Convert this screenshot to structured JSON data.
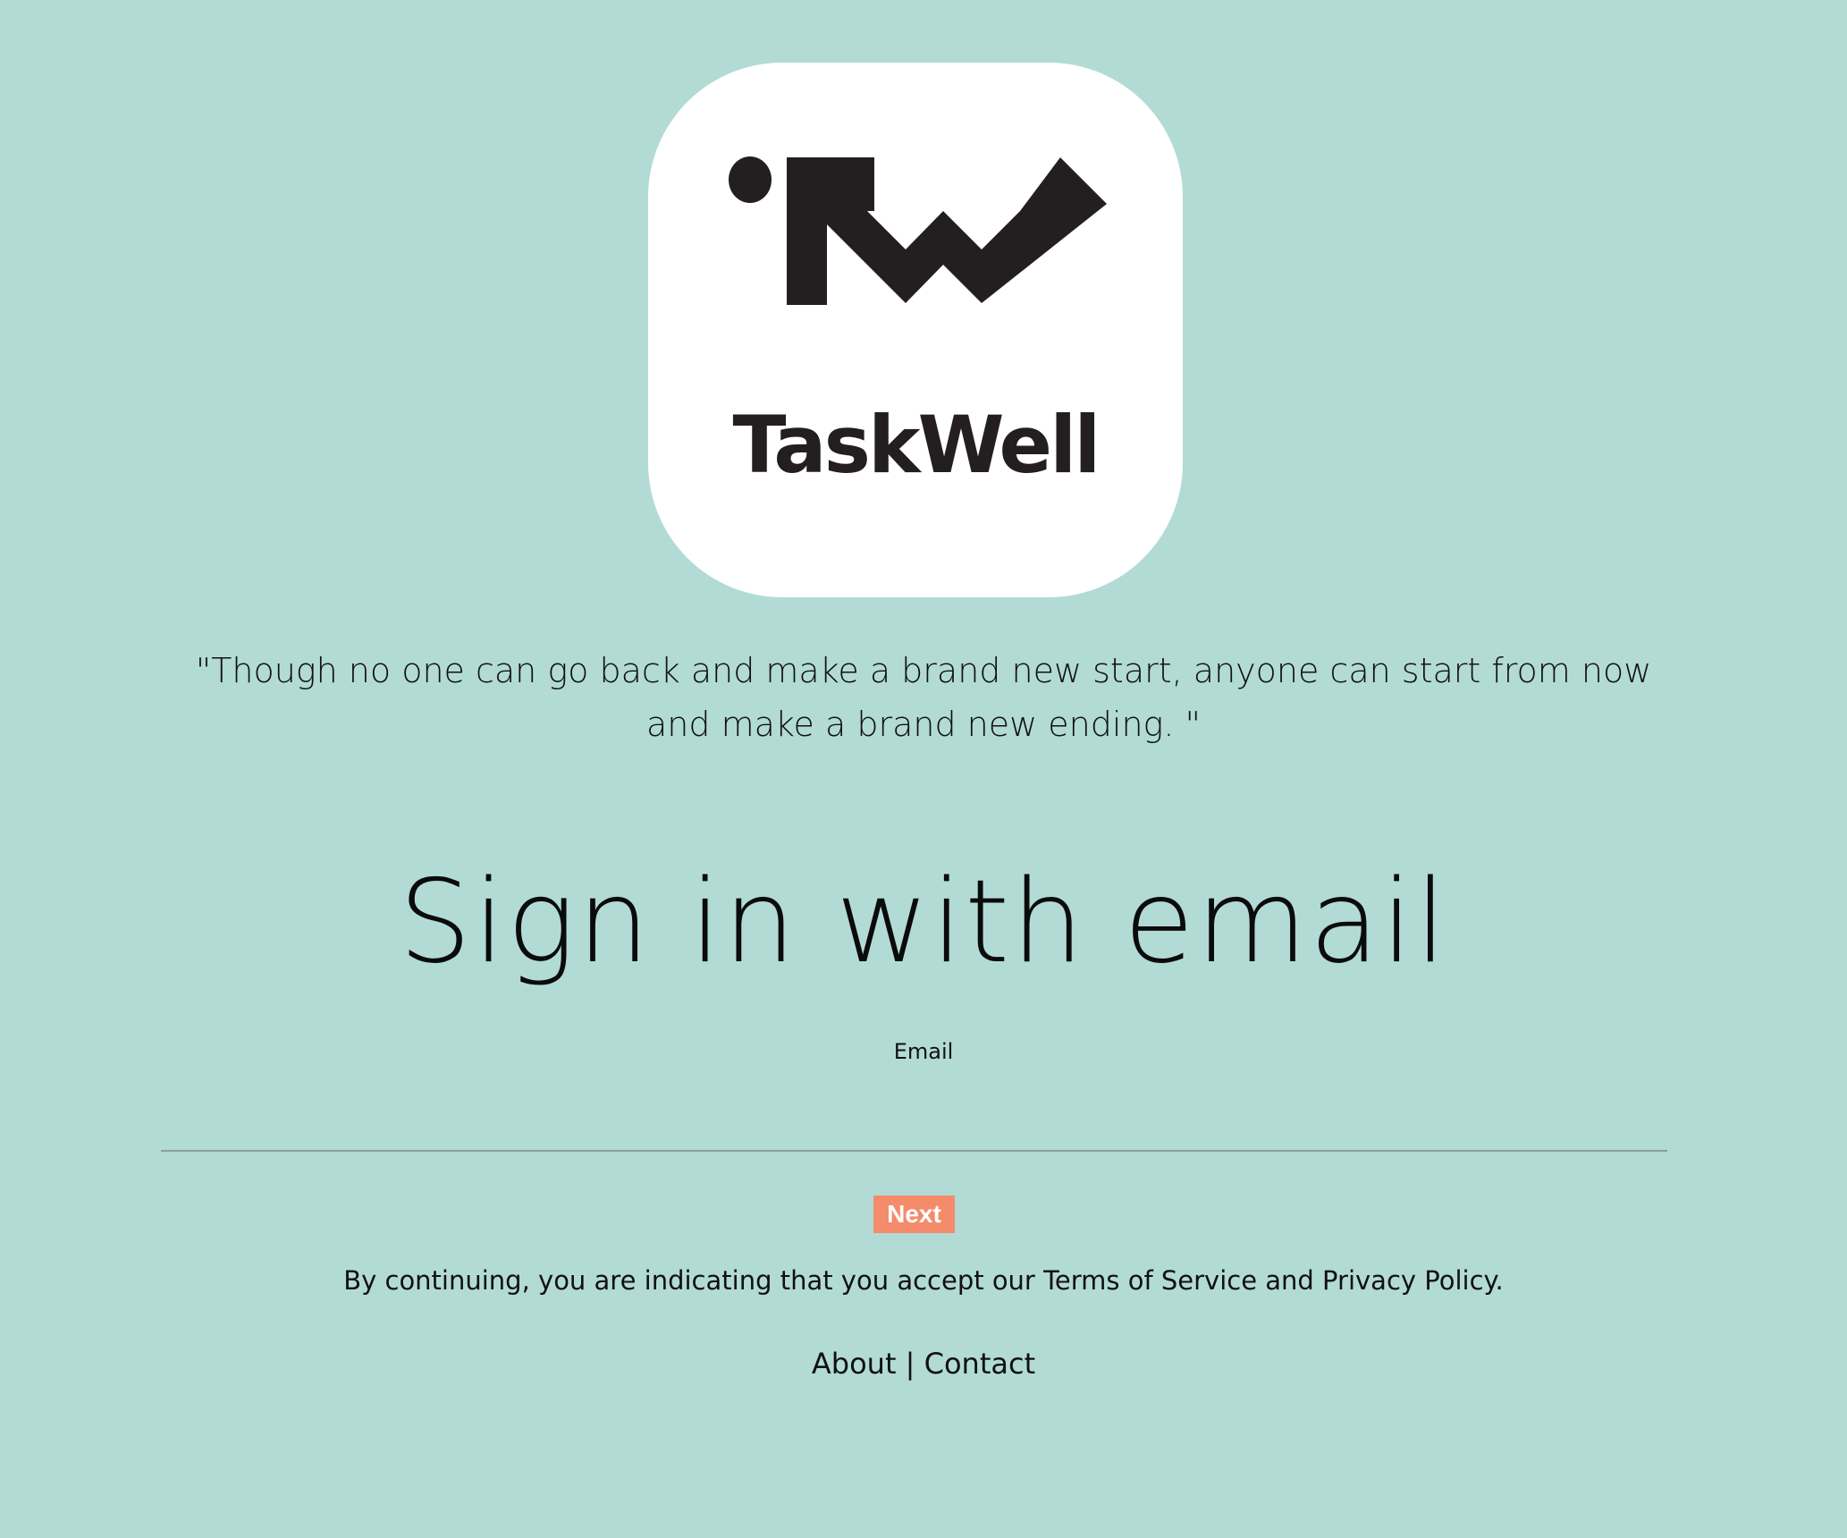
{
  "brand": {
    "name": "TaskWell",
    "mark_icon": "taskwell-tw-logo"
  },
  "quote": "\"Though no one can go back and make a brand new start, anyone can start from now and make a brand new ending. \"",
  "signin": {
    "heading": "Sign in with email",
    "email_label": "Email",
    "email_value": "",
    "next_label": "Next"
  },
  "terms": {
    "prefix": "By continuing, you are indicating that you accept our ",
    "terms_link": "Terms of Service",
    "middle": " and ",
    "privacy_link": "Privacy Policy",
    "suffix": "."
  },
  "footer": {
    "about": "About",
    "separator": " | ",
    "contact": "Contact"
  },
  "colors": {
    "background": "#b2dbd5",
    "card": "#ffffff",
    "logo_ink": "#231f20",
    "next_button": "#f48b6a",
    "input_underline": "#8a9e9b"
  }
}
